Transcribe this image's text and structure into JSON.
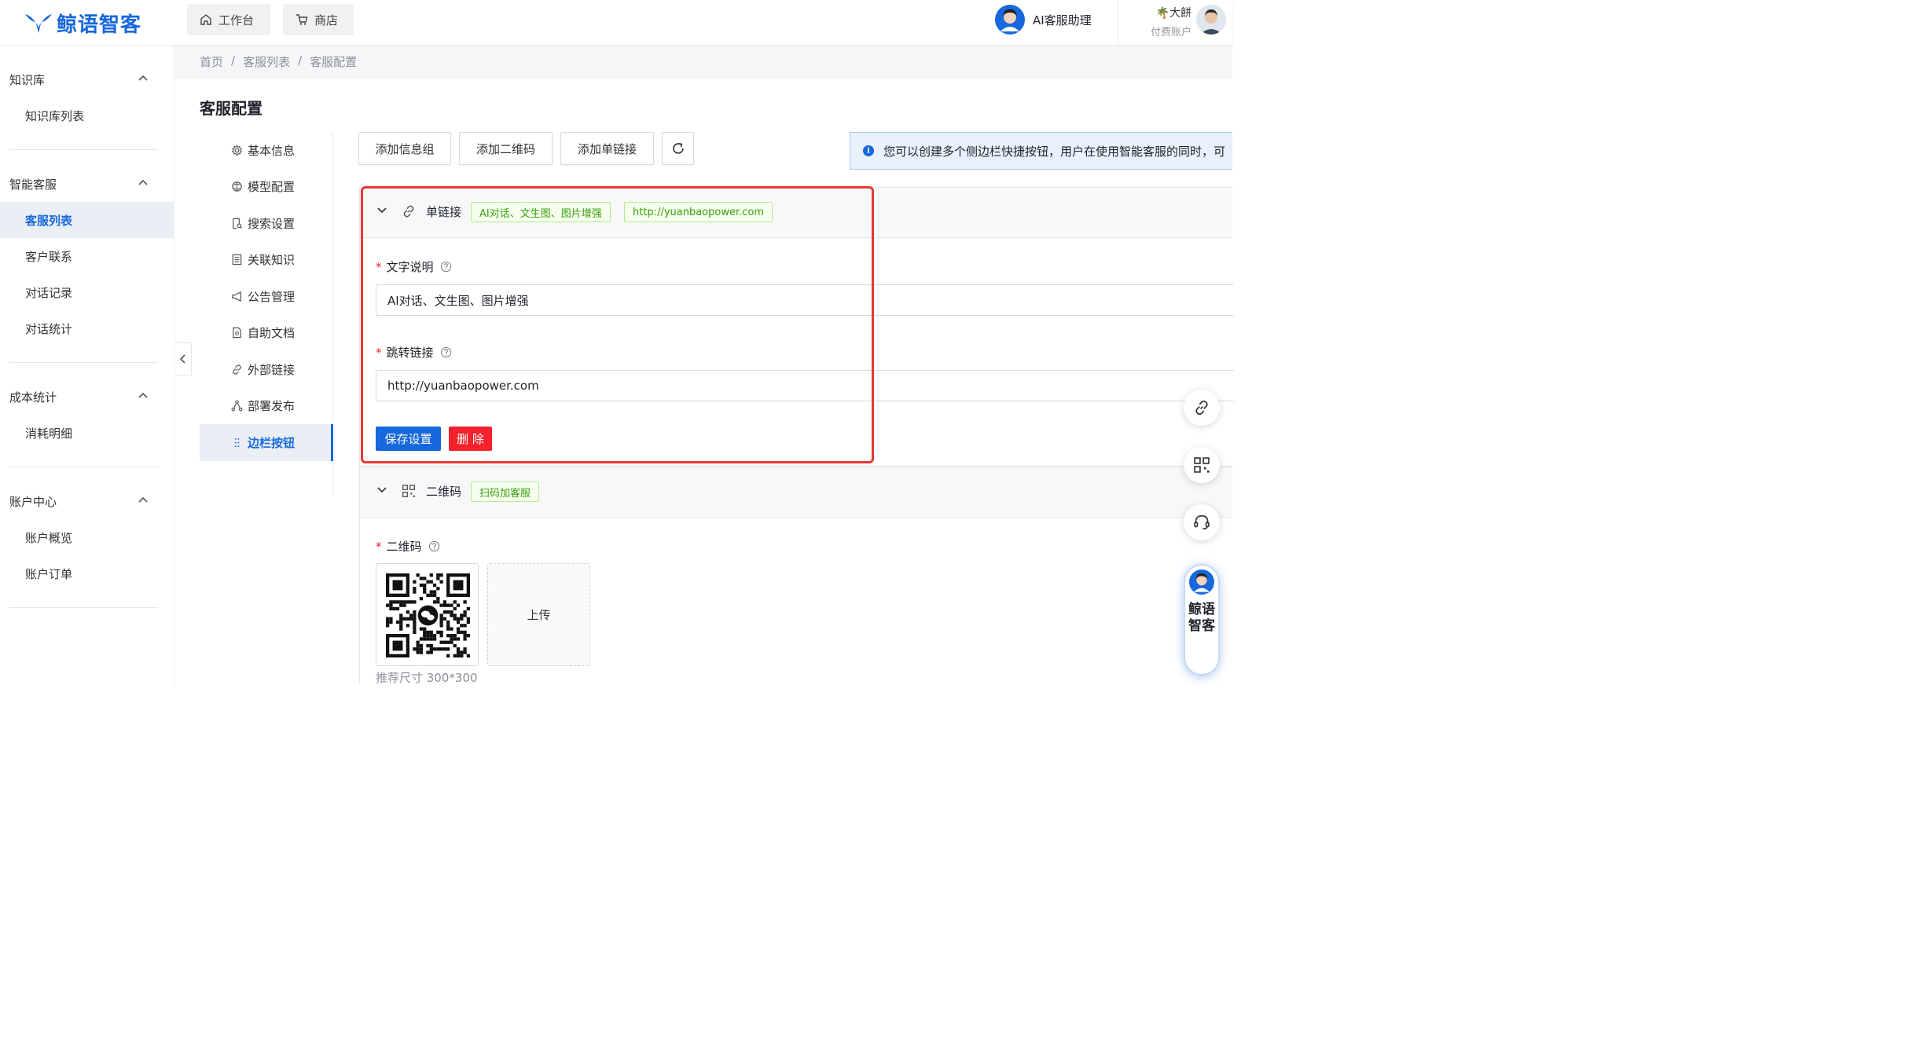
{
  "brand": {
    "name": "鲸语智客"
  },
  "topnav": [
    {
      "label": "工作台",
      "icon": "home-icon"
    },
    {
      "label": "商店",
      "icon": "cart-icon"
    }
  ],
  "assistant": {
    "label": "AI客服助理"
  },
  "user": {
    "name": "大餅",
    "account_type": "付费账户"
  },
  "sidebar": {
    "groups": [
      {
        "label": "知识库",
        "items": [
          "知识库列表"
        ]
      },
      {
        "label": "智能客服",
        "items": [
          "客服列表",
          "客户联系",
          "对话记录",
          "对话统计"
        ],
        "active": "客服列表"
      },
      {
        "label": "成本统计",
        "items": [
          "消耗明细"
        ]
      },
      {
        "label": "账户中心",
        "items": [
          "账户概览",
          "账户订单"
        ]
      }
    ]
  },
  "breadcrumb": [
    "首页",
    "客服列表",
    "客服配置"
  ],
  "page_title": "客服配置",
  "config_nav": [
    {
      "label": "基本信息",
      "icon": "gear-icon"
    },
    {
      "label": "模型配置",
      "icon": "model-icon"
    },
    {
      "label": "搜索设置",
      "icon": "search-doc-icon"
    },
    {
      "label": "关联知识",
      "icon": "list-doc-icon"
    },
    {
      "label": "公告管理",
      "icon": "megaphone-icon"
    },
    {
      "label": "自助文档",
      "icon": "document-icon"
    },
    {
      "label": "外部链接",
      "icon": "link-icon"
    },
    {
      "label": "部署发布",
      "icon": "deploy-icon"
    },
    {
      "label": "边栏按钮",
      "icon": "grip-icon",
      "active": true
    }
  ],
  "toolbar": {
    "add_group": "添加信息组",
    "add_qrcode": "添加二维码",
    "add_link": "添加单链接"
  },
  "info_alert": "您可以创建多个侧边栏快捷按钮，用户在使用智能客服的同时，可",
  "link_panel": {
    "type_label": "单链接",
    "tag_title": "AI对话、文生图、图片增强",
    "tag_url": "http://yuanbaopower.com",
    "text_label": "文字说明",
    "text_value": "AI对话、文生图、图片增强",
    "url_label": "跳转链接",
    "url_value": "http://yuanbaopower.com",
    "save_label": "保存设置",
    "delete_label": "删 除"
  },
  "qr_panel": {
    "type_label": "二维码",
    "tag_title": "扫码加客服",
    "qr_label": "二维码",
    "upload_label": "上传",
    "hint": "推荐尺寸 300*300"
  },
  "floating": {
    "pill_text": "鲸语智客"
  },
  "colors": {
    "primary": "#1668dc",
    "danger": "#f5222d",
    "success_tag": "#389e0d",
    "highlight_box": "#e53935"
  }
}
